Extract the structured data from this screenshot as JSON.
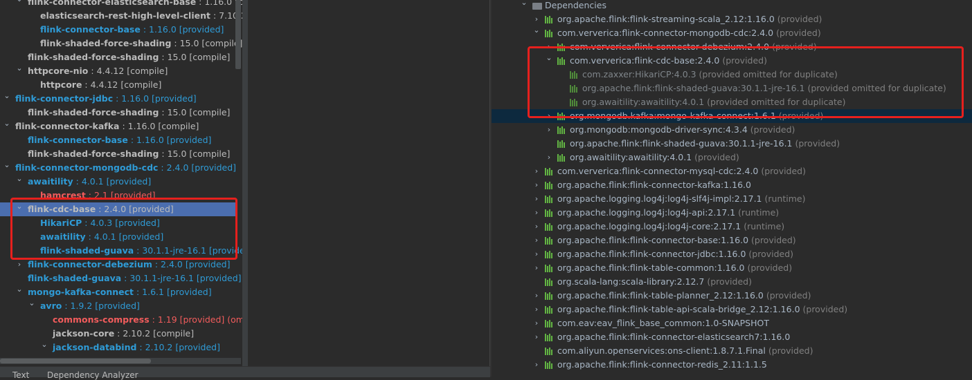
{
  "left_tree": [
    {
      "ind": 22,
      "exp": true,
      "name": "flink-connector-elasticsearch-base",
      "meta": " : 1.16.0 [compile]",
      "nc": "def",
      "mc": "def"
    },
    {
      "ind": 40,
      "exp": null,
      "name": "elasticsearch-rest-high-level-client",
      "meta": " : 7.10.2 [compile]",
      "nc": "def",
      "mc": "def"
    },
    {
      "ind": 40,
      "exp": null,
      "name": "flink-connector-base",
      "meta": " : 1.16.0 [provided]",
      "nc": "blue",
      "mc": "blue"
    },
    {
      "ind": 40,
      "exp": null,
      "name": "flink-shaded-force-shading",
      "meta": " : 15.0 [compile]",
      "nc": "def",
      "mc": "def"
    },
    {
      "ind": 22,
      "exp": null,
      "name": "flink-shaded-force-shading",
      "meta": " : 15.0 [compile]",
      "nc": "def",
      "mc": "def"
    },
    {
      "ind": 22,
      "exp": true,
      "name": "httpcore-nio",
      "meta": " : 4.4.12 [compile]",
      "nc": "def",
      "mc": "def"
    },
    {
      "ind": 40,
      "exp": null,
      "name": "httpcore",
      "meta": " : 4.4.12 [compile]",
      "nc": "def",
      "mc": "def"
    },
    {
      "ind": 4,
      "exp": true,
      "name": "flink-connector-jdbc",
      "meta": " : 1.16.0 [provided]",
      "nc": "blue",
      "mc": "blue"
    },
    {
      "ind": 22,
      "exp": null,
      "name": "flink-shaded-force-shading",
      "meta": " : 15.0 [compile]",
      "nc": "def",
      "mc": "def"
    },
    {
      "ind": 4,
      "exp": true,
      "name": "flink-connector-kafka",
      "meta": " : 1.16.0 [compile]",
      "nc": "def",
      "mc": "def"
    },
    {
      "ind": 22,
      "exp": null,
      "name": "flink-connector-base",
      "meta": " : 1.16.0 [provided]",
      "nc": "blue",
      "mc": "blue"
    },
    {
      "ind": 22,
      "exp": null,
      "name": "flink-shaded-force-shading",
      "meta": " : 15.0 [compile]",
      "nc": "def",
      "mc": "def"
    },
    {
      "ind": 4,
      "exp": true,
      "name": "flink-connector-mongodb-cdc",
      "meta": " : 2.4.0 [provided]",
      "nc": "blue",
      "mc": "blue"
    },
    {
      "ind": 22,
      "exp": true,
      "name": "awaitility",
      "meta": " : 4.0.1 [provided]",
      "nc": "blue",
      "mc": "blue"
    },
    {
      "ind": 40,
      "exp": null,
      "name": "hamcrest",
      "meta": " : 2.1 [provided]",
      "nc": "red",
      "mc": "red"
    },
    {
      "ind": 22,
      "exp": true,
      "name": "flink-cdc-base",
      "meta": " : 2.4.0 [provided]",
      "nc": "def",
      "mc": "def",
      "sel": true
    },
    {
      "ind": 40,
      "exp": null,
      "name": "HikariCP",
      "meta": " : 4.0.3 [provided]",
      "nc": "blue",
      "mc": "blue"
    },
    {
      "ind": 40,
      "exp": null,
      "name": "awaitility",
      "meta": " : 4.0.1 [provided]",
      "nc": "blue",
      "mc": "blue"
    },
    {
      "ind": 40,
      "exp": null,
      "name": "flink-shaded-guava",
      "meta": " : 30.1.1-jre-16.1 [provided]",
      "nc": "blue",
      "mc": "blue"
    },
    {
      "ind": 22,
      "exp": false,
      "name": "flink-connector-debezium",
      "meta": " : 2.4.0 [provided]",
      "nc": "blue",
      "mc": "blue"
    },
    {
      "ind": 22,
      "exp": null,
      "name": "flink-shaded-guava",
      "meta": " : 30.1.1-jre-16.1 [provided]",
      "nc": "blue",
      "mc": "blue"
    },
    {
      "ind": 22,
      "exp": true,
      "name": "mongo-kafka-connect",
      "meta": " : 1.6.1 [provided]",
      "nc": "blue",
      "mc": "blue"
    },
    {
      "ind": 40,
      "exp": true,
      "name": "avro",
      "meta": " : 1.9.2 [provided]",
      "nc": "blue",
      "mc": "blue"
    },
    {
      "ind": 58,
      "exp": null,
      "name": "commons-compress",
      "meta": " : 1.19 [provided] (omitt",
      "nc": "red",
      "mc": "red"
    },
    {
      "ind": 58,
      "exp": null,
      "name": "jackson-core",
      "meta": " : 2.10.2 [compile]",
      "nc": "def",
      "mc": "def"
    },
    {
      "ind": 58,
      "exp": true,
      "name": "jackson-databind",
      "meta": " : 2.10.2 [provided]",
      "nc": "blue",
      "mc": "blue"
    }
  ],
  "right_tree": [
    {
      "ind": 44,
      "exp": true,
      "folder": true,
      "name": "Dependencies",
      "meta": ""
    },
    {
      "ind": 62,
      "exp": false,
      "name": "org.apache.flink:flink-streaming-scala_2.12:1.16.0",
      "meta": " (provided)"
    },
    {
      "ind": 62,
      "exp": true,
      "name": "com.ververica:flink-connector-mongodb-cdc:2.4.0",
      "meta": " (provided)"
    },
    {
      "ind": 80,
      "exp": false,
      "name": "com.ververica:flink-connector-debezium:2.4.0",
      "meta": " (provided)"
    },
    {
      "ind": 80,
      "exp": true,
      "name": "com.ververica:flink-cdc-base:2.4.0",
      "meta": " (provided)"
    },
    {
      "ind": 98,
      "exp": null,
      "dim": true,
      "name": "com.zaxxer:HikariCP:4.0.3",
      "meta": " (provided omitted for duplicate)"
    },
    {
      "ind": 98,
      "exp": null,
      "dim": true,
      "name": "org.apache.flink:flink-shaded-guava:30.1.1-jre-16.1",
      "meta": " (provided omitted for duplicate)"
    },
    {
      "ind": 98,
      "exp": null,
      "dim": true,
      "name": "org.awaitility:awaitility:4.0.1",
      "meta": " (provided omitted for duplicate)"
    },
    {
      "ind": 80,
      "exp": false,
      "name": "org.mongodb.kafka:mongo-kafka-connect:1.6.1",
      "meta": " (provided)",
      "hl": true
    },
    {
      "ind": 80,
      "exp": false,
      "name": "org.mongodb:mongodb-driver-sync:4.3.4",
      "meta": " (provided)"
    },
    {
      "ind": 80,
      "exp": null,
      "name": "org.apache.flink:flink-shaded-guava:30.1.1-jre-16.1",
      "meta": " (provided)"
    },
    {
      "ind": 80,
      "exp": false,
      "name": "org.awaitility:awaitility:4.0.1",
      "meta": " (provided)"
    },
    {
      "ind": 62,
      "exp": false,
      "name": "com.ververica:flink-connector-mysql-cdc:2.4.0",
      "meta": " (provided)"
    },
    {
      "ind": 62,
      "exp": false,
      "name": "org.apache.flink:flink-connector-kafka:1.16.0",
      "meta": ""
    },
    {
      "ind": 62,
      "exp": false,
      "name": "org.apache.logging.log4j:log4j-slf4j-impl:2.17.1",
      "meta": " (runtime)"
    },
    {
      "ind": 62,
      "exp": false,
      "name": "org.apache.logging.log4j:log4j-api:2.17.1",
      "meta": " (runtime)"
    },
    {
      "ind": 62,
      "exp": false,
      "name": "org.apache.logging.log4j:log4j-core:2.17.1",
      "meta": " (runtime)"
    },
    {
      "ind": 62,
      "exp": false,
      "name": "org.apache.flink:flink-connector-base:1.16.0",
      "meta": " (provided)"
    },
    {
      "ind": 62,
      "exp": false,
      "name": "org.apache.flink:flink-connector-jdbc:1.16.0",
      "meta": " (provided)"
    },
    {
      "ind": 62,
      "exp": false,
      "name": "org.apache.flink:flink-table-common:1.16.0",
      "meta": " (provided)"
    },
    {
      "ind": 62,
      "exp": null,
      "name": "org.scala-lang:scala-library:2.12.7",
      "meta": " (provided)"
    },
    {
      "ind": 62,
      "exp": false,
      "name": "org.apache.flink:flink-table-planner_2.12:1.16.0",
      "meta": " (provided)"
    },
    {
      "ind": 62,
      "exp": false,
      "name": "org.apache.flink:flink-table-api-scala-bridge_2.12:1.16.0",
      "meta": " (provided)"
    },
    {
      "ind": 62,
      "exp": false,
      "name": "com.eav:eav_flink_base_common:1.0-SNAPSHOT",
      "meta": ""
    },
    {
      "ind": 62,
      "exp": false,
      "name": "org.apache.flink:flink-connector-elasticsearch7:1.16.0",
      "meta": ""
    },
    {
      "ind": 62,
      "exp": null,
      "name": "com.aliyun.openservices:ons-client:1.8.7.1.Final",
      "meta": " (provided)"
    },
    {
      "ind": 62,
      "exp": false,
      "name": "org.apache.flink:flink-connector-redis_2.11:1.1.5",
      "meta": ""
    }
  ],
  "bottom_tabs": {
    "text": "Text",
    "analyzer": "Dependency Analyzer"
  },
  "colors": {
    "selection": "#4b6eaf",
    "highlight_box": "#e6201d",
    "provided": "#2f9bd6",
    "conflict": "#f25c5c"
  }
}
